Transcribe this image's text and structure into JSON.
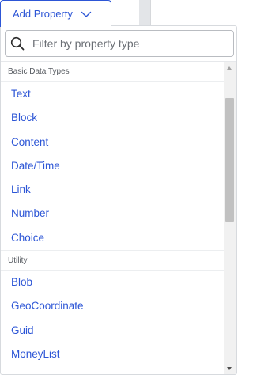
{
  "add_property": {
    "label": "Add Property",
    "icon": "chevron-down-icon"
  },
  "search": {
    "placeholder": "Filter by property type",
    "value": "",
    "icon": "search-icon"
  },
  "groups": [
    {
      "header": "Basic Data Types",
      "items": [
        "Text",
        "Block",
        "Content",
        "Date/Time",
        "Link",
        "Number",
        "Choice"
      ]
    },
    {
      "header": "Utility",
      "items": [
        "Blob",
        "GeoCoordinate",
        "Guid",
        "MoneyList"
      ]
    }
  ],
  "colors": {
    "accent": "#2d56d6",
    "header_text": "#55595f",
    "border": "#d7dade"
  }
}
